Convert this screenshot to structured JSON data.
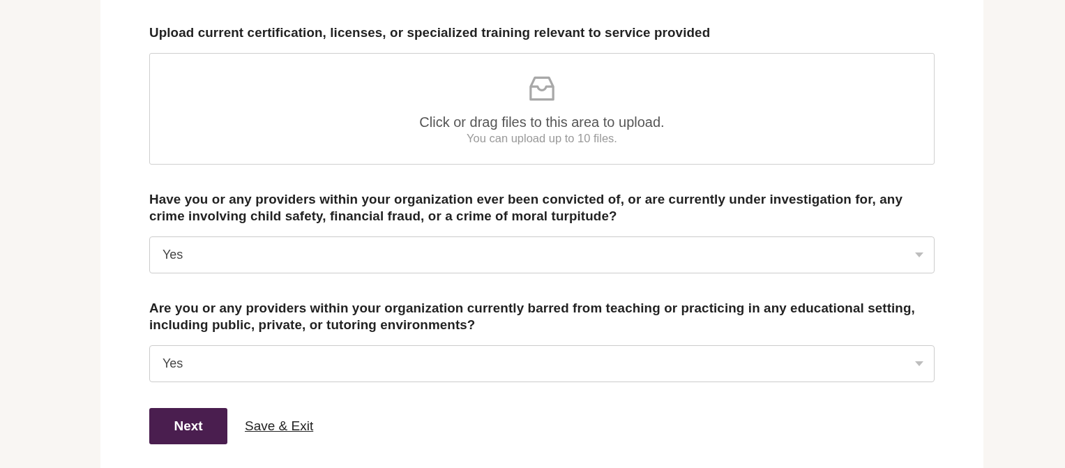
{
  "fields": [
    {
      "kind": "upload",
      "label": "Upload current certification, licenses, or specialized training relevant to service provided",
      "prompt": "Click or drag files to this area to upload.",
      "hint": "You can upload up to 10 files."
    },
    {
      "kind": "select",
      "label": "Have you or any providers within your organization ever been convicted of, or are currently under investigation for, any crime involving child safety, financial fraud, or a crime of moral turpitude?",
      "value": "Yes"
    },
    {
      "kind": "select",
      "label": "Are you or any providers within your organization currently barred from teaching or practicing in any educational setting, including public, private, or tutoring environments?",
      "value": "Yes"
    }
  ],
  "actions": [
    {
      "kind": "primary",
      "label": "Next"
    },
    {
      "kind": "link",
      "label": "Save & Exit"
    }
  ]
}
